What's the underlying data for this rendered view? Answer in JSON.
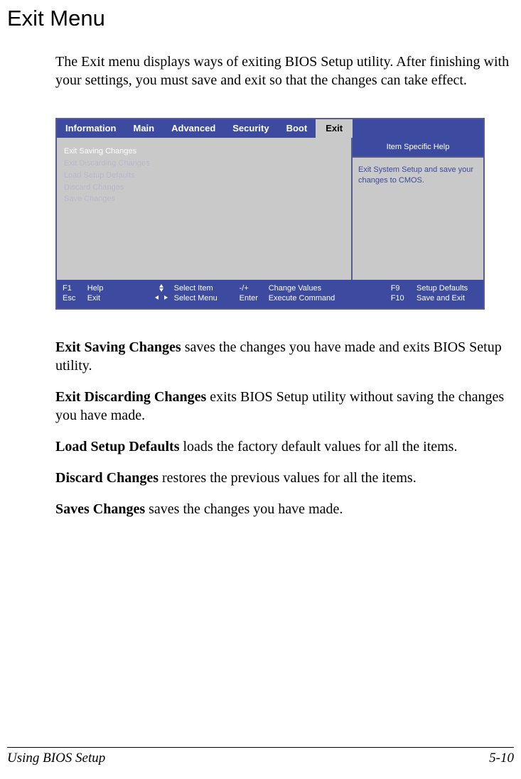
{
  "title": "Exit Menu",
  "intro": "The Exit menu displays ways of exiting BIOS Setup utility. After finishing with your settings, you must save and exit so that the changes can take effect.",
  "bios": {
    "tabs": [
      "Information",
      "Main",
      "Advanced",
      "Security",
      "Boot",
      "Exit"
    ],
    "selected_tab": "Exit",
    "menu_items": [
      "Exit Saving Changes",
      "Exit Discarding Changes",
      "Load Setup Defaults",
      "Discard Changes",
      "Save Changes"
    ],
    "help_header": "Item Specific Help",
    "help_body": "Exit System Setup and save your changes to CMOS.",
    "footer": {
      "f1": "F1",
      "esc": "Esc",
      "help": "Help",
      "exit": "Exit",
      "select_item": "Select Item",
      "select_menu": "Select Menu",
      "minus_plus": "-/+",
      "enter": "Enter",
      "change_values": "Change Values",
      "execute_command": "Execute Command",
      "f9": "F9",
      "f10": "F10",
      "setup_defaults": "Setup Defaults",
      "save_and_exit": "Save and Exit"
    }
  },
  "definitions": [
    {
      "term": "Exit Saving Changes",
      "desc": "  saves the changes you have made and exits BIOS Setup utility."
    },
    {
      "term": "Exit Discarding Changes",
      "desc": "  exits BIOS Setup utility without saving the changes you have made."
    },
    {
      "term": "Load Setup Defaults",
      "desc": "  loads the factory default values for all the items."
    },
    {
      "term": "Discard Changes",
      "desc": "  restores the previous values for all the items."
    },
    {
      "term": "Saves Changes",
      "desc": "  saves the changes you have made."
    }
  ],
  "footer": {
    "left": "Using BIOS Setup",
    "right": "5-10"
  }
}
